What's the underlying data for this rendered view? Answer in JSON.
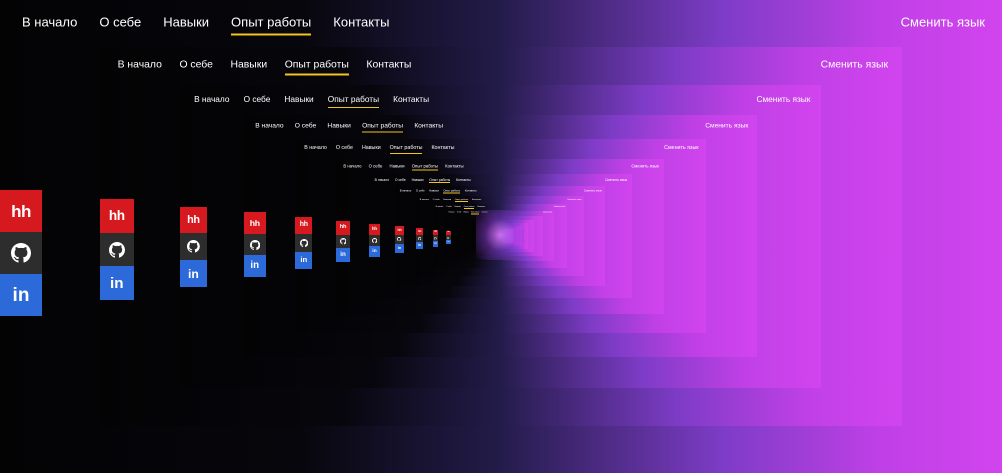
{
  "nav": {
    "items": [
      {
        "label": "В начало"
      },
      {
        "label": "О себе"
      },
      {
        "label": "Навыки"
      },
      {
        "label": "Опыт работы",
        "active": true
      },
      {
        "label": "Контакты"
      }
    ],
    "language_button": "Сменить язык"
  },
  "social": [
    {
      "id": "hh",
      "label": "hh",
      "icon": "hh-logo-icon",
      "color": "#d6191f"
    },
    {
      "id": "github",
      "label": "",
      "icon": "github-icon",
      "color": "#2d2d2e"
    },
    {
      "id": "linkedin",
      "label": "in",
      "icon": "linkedin-icon",
      "color": "#2b6ad8"
    }
  ],
  "colors": {
    "accent_underline": "#f3c322",
    "gradient_dark": "#030304",
    "gradient_light": "#d144ee"
  }
}
